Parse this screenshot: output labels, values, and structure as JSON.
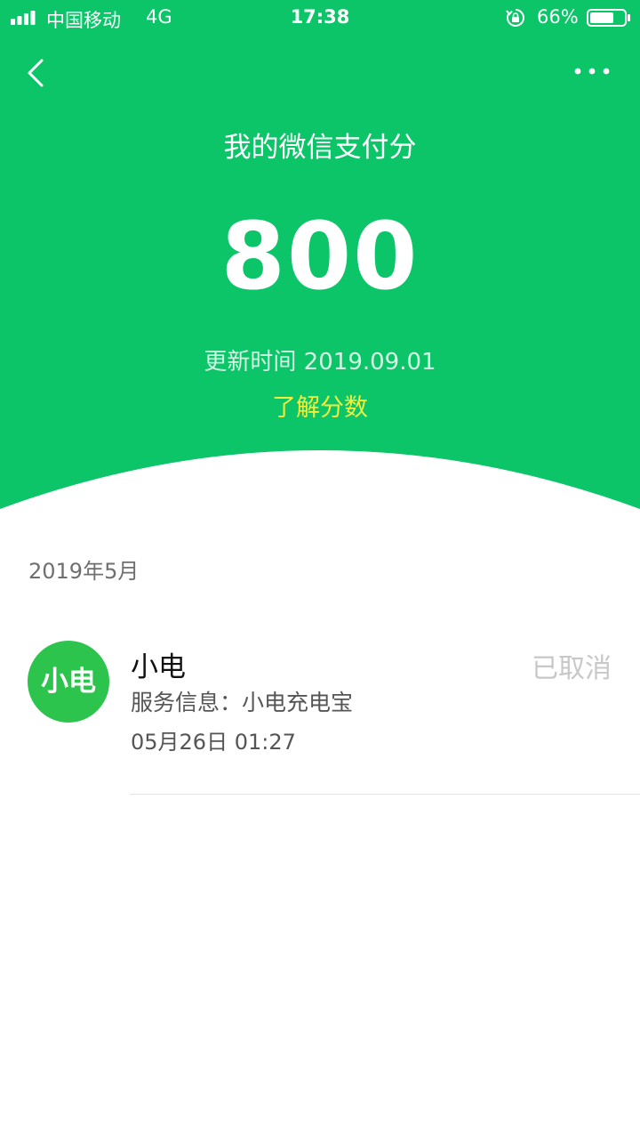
{
  "status_bar": {
    "carrier": "中国移动",
    "network": "4G",
    "time": "17:38",
    "battery": "66%"
  },
  "header": {
    "title": "我的微信支付分",
    "score": "800",
    "update_time": "更新时间 2019.09.01",
    "learn_link": "了解分数"
  },
  "records": {
    "month": "2019年5月",
    "items": [
      {
        "avatar_text": "小电",
        "name": "小电",
        "service": "服务信息：小电充电宝",
        "datetime": "05月26日 01:27",
        "status": "已取消"
      }
    ]
  },
  "colors": {
    "header_bg": "#0bc568",
    "link": "#f4ef3b",
    "avatar_bg": "#2dc44d"
  }
}
